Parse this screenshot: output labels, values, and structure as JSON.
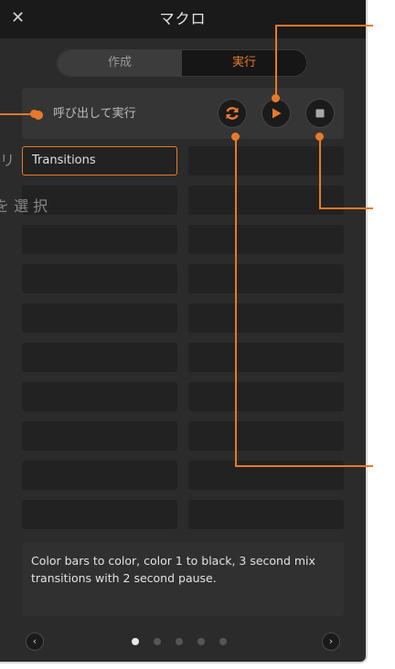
{
  "window": {
    "title": "マクロ",
    "close_icon": "close-icon"
  },
  "tabs": [
    {
      "label": "作成",
      "active": false
    },
    {
      "label": "実行",
      "active": true
    }
  ],
  "controls": {
    "recall_label": "呼び出して実行",
    "loop_icon": "loop-icon",
    "play_icon": "play-icon",
    "stop_icon": "stop-icon"
  },
  "macros": {
    "selected_name": "Transitions"
  },
  "description": "Color bars to color, color 1 to black, 3 second mix transitions with 2 second pause.",
  "pagination": {
    "current_page": 1,
    "total_pages": 5,
    "prev_icon": "chevron-left-icon",
    "next_icon": "chevron-right-icon"
  },
  "background_text": {
    "fragment_1": "リ",
    "fragment_2": "を 選 択"
  },
  "colors": {
    "accent": "#e8792b",
    "panel": "#2b2b2b",
    "titlebar": "#1a1a1a"
  }
}
